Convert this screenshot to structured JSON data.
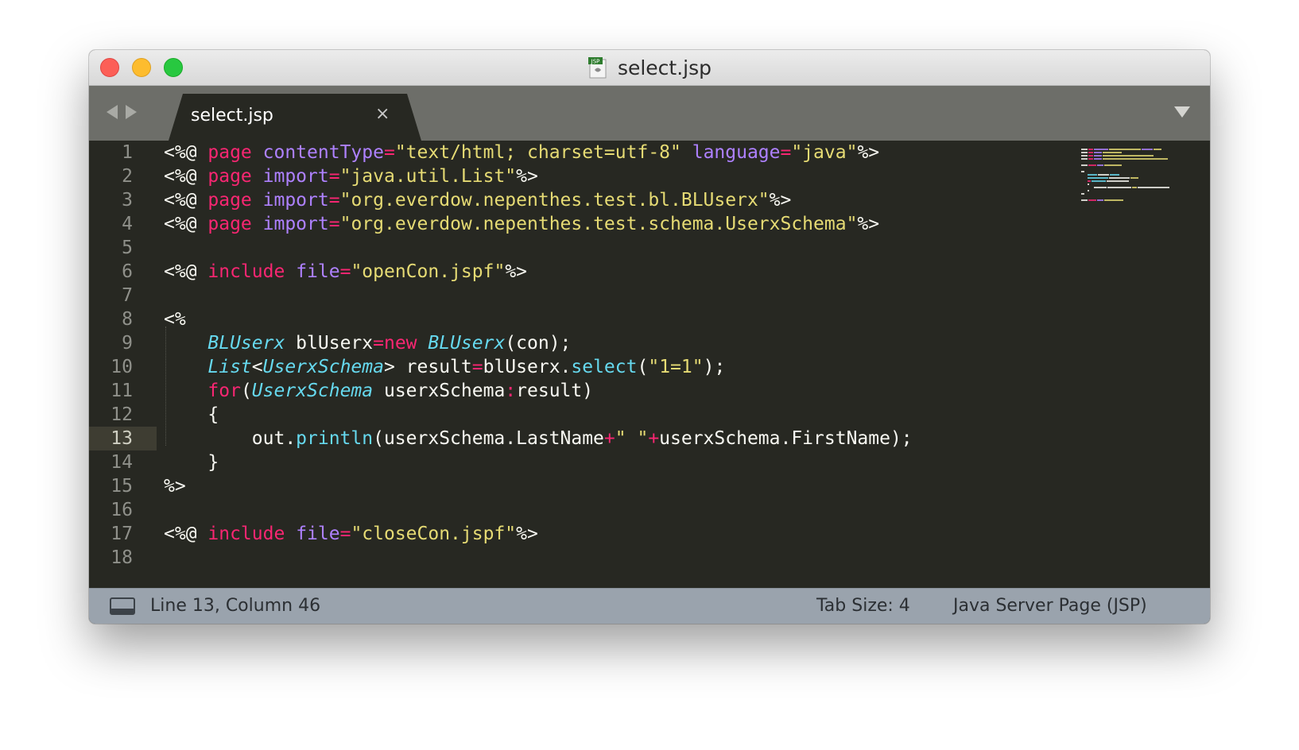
{
  "window": {
    "title": "select.jsp",
    "file_icon_badge": "JSP"
  },
  "tabs": [
    {
      "label": "select.jsp",
      "close_glyph": "×"
    }
  ],
  "editor": {
    "current_line": 13,
    "lines": [
      {
        "number": "1",
        "tokens": [
          {
            "t": "<%@ ",
            "c": "pl"
          },
          {
            "t": "page",
            "c": "kw"
          },
          {
            "t": " ",
            "c": "pl"
          },
          {
            "t": "contentType",
            "c": "at"
          },
          {
            "t": "=",
            "c": "kw"
          },
          {
            "t": "\"text/html; charset=utf-8\"",
            "c": "st"
          },
          {
            "t": " ",
            "c": "pl"
          },
          {
            "t": "language",
            "c": "at"
          },
          {
            "t": "=",
            "c": "kw"
          },
          {
            "t": "\"java\"",
            "c": "st"
          },
          {
            "t": "%>",
            "c": "pl"
          }
        ]
      },
      {
        "number": "2",
        "tokens": [
          {
            "t": "<%@ ",
            "c": "pl"
          },
          {
            "t": "page",
            "c": "kw"
          },
          {
            "t": " ",
            "c": "pl"
          },
          {
            "t": "import",
            "c": "at"
          },
          {
            "t": "=",
            "c": "kw"
          },
          {
            "t": "\"java.util.List\"",
            "c": "st"
          },
          {
            "t": "%>",
            "c": "pl"
          }
        ]
      },
      {
        "number": "3",
        "tokens": [
          {
            "t": "<%@ ",
            "c": "pl"
          },
          {
            "t": "page",
            "c": "kw"
          },
          {
            "t": " ",
            "c": "pl"
          },
          {
            "t": "import",
            "c": "at"
          },
          {
            "t": "=",
            "c": "kw"
          },
          {
            "t": "\"org.everdow.nepenthes.test.bl.BLUserx\"",
            "c": "st"
          },
          {
            "t": "%>",
            "c": "pl"
          }
        ]
      },
      {
        "number": "4",
        "tokens": [
          {
            "t": "<%@ ",
            "c": "pl"
          },
          {
            "t": "page",
            "c": "kw"
          },
          {
            "t": " ",
            "c": "pl"
          },
          {
            "t": "import",
            "c": "at"
          },
          {
            "t": "=",
            "c": "kw"
          },
          {
            "t": "\"org.everdow.nepenthes.test.schema.UserxSchema\"",
            "c": "st"
          },
          {
            "t": "%>",
            "c": "pl"
          }
        ]
      },
      {
        "number": "5",
        "tokens": []
      },
      {
        "number": "6",
        "tokens": [
          {
            "t": "<%@ ",
            "c": "pl"
          },
          {
            "t": "include",
            "c": "kw"
          },
          {
            "t": " ",
            "c": "pl"
          },
          {
            "t": "file",
            "c": "at"
          },
          {
            "t": "=",
            "c": "kw"
          },
          {
            "t": "\"openCon.jspf\"",
            "c": "st"
          },
          {
            "t": "%>",
            "c": "pl"
          }
        ]
      },
      {
        "number": "7",
        "tokens": []
      },
      {
        "number": "8",
        "tokens": [
          {
            "t": "<%",
            "c": "pl"
          }
        ]
      },
      {
        "number": "9",
        "tokens": [
          {
            "t": "    ",
            "c": "pl"
          },
          {
            "t": "BLUserx",
            "c": "ty"
          },
          {
            "t": " blUserx",
            "c": "pl"
          },
          {
            "t": "=",
            "c": "kw"
          },
          {
            "t": "new",
            "c": "kw"
          },
          {
            "t": " ",
            "c": "pl"
          },
          {
            "t": "BLUserx",
            "c": "ty"
          },
          {
            "t": "(con);",
            "c": "pl"
          }
        ]
      },
      {
        "number": "10",
        "tokens": [
          {
            "t": "    ",
            "c": "pl"
          },
          {
            "t": "List",
            "c": "ty"
          },
          {
            "t": "<",
            "c": "pl"
          },
          {
            "t": "UserxSchema",
            "c": "ty"
          },
          {
            "t": "> result",
            "c": "pl"
          },
          {
            "t": "=",
            "c": "kw"
          },
          {
            "t": "blUserx.",
            "c": "pl"
          },
          {
            "t": "select",
            "c": "fn"
          },
          {
            "t": "(",
            "c": "pl"
          },
          {
            "t": "\"1=1\"",
            "c": "st"
          },
          {
            "t": ");",
            "c": "pl"
          }
        ]
      },
      {
        "number": "11",
        "tokens": [
          {
            "t": "    ",
            "c": "pl"
          },
          {
            "t": "for",
            "c": "kw"
          },
          {
            "t": "(",
            "c": "pl"
          },
          {
            "t": "UserxSchema",
            "c": "ty"
          },
          {
            "t": " userxSchema",
            "c": "pl"
          },
          {
            "t": ":",
            "c": "kw"
          },
          {
            "t": "result)",
            "c": "pl"
          }
        ]
      },
      {
        "number": "12",
        "tokens": [
          {
            "t": "    {",
            "c": "pl"
          }
        ]
      },
      {
        "number": "13",
        "tokens": [
          {
            "t": "        out.",
            "c": "pl"
          },
          {
            "t": "println",
            "c": "fn"
          },
          {
            "t": "(userxSchema.LastName",
            "c": "pl"
          },
          {
            "t": "+",
            "c": "kw"
          },
          {
            "t": "\" \"",
            "c": "st"
          },
          {
            "t": "+",
            "c": "kw"
          },
          {
            "t": "userxSchema.FirstName);",
            "c": "pl"
          }
        ]
      },
      {
        "number": "14",
        "tokens": [
          {
            "t": "    }",
            "c": "pl"
          }
        ]
      },
      {
        "number": "15",
        "tokens": [
          {
            "t": "%>",
            "c": "pl"
          }
        ]
      },
      {
        "number": "16",
        "tokens": []
      },
      {
        "number": "17",
        "tokens": [
          {
            "t": "<%@ ",
            "c": "pl"
          },
          {
            "t": "include",
            "c": "kw"
          },
          {
            "t": " ",
            "c": "pl"
          },
          {
            "t": "file",
            "c": "at"
          },
          {
            "t": "=",
            "c": "kw"
          },
          {
            "t": "\"closeCon.jspf\"",
            "c": "st"
          },
          {
            "t": "%>",
            "c": "pl"
          }
        ]
      },
      {
        "number": "18",
        "tokens": []
      }
    ]
  },
  "status": {
    "position": "Line 13, Column 46",
    "tab_size": "Tab Size: 4",
    "syntax": "Java Server Page (JSP)"
  },
  "colors": {
    "background": "#272822",
    "plain": "#f8f8f2",
    "keyword": "#f92672",
    "attribute": "#ae81ff",
    "string": "#e6db74",
    "type": "#66d9ef",
    "statusbar": "#9aa3ad"
  },
  "icons": [
    "file-jsp-icon",
    "back-arrow-icon",
    "forward-arrow-icon",
    "tab-close-icon",
    "tabs-dropdown-icon",
    "panel-toggle-icon"
  ]
}
